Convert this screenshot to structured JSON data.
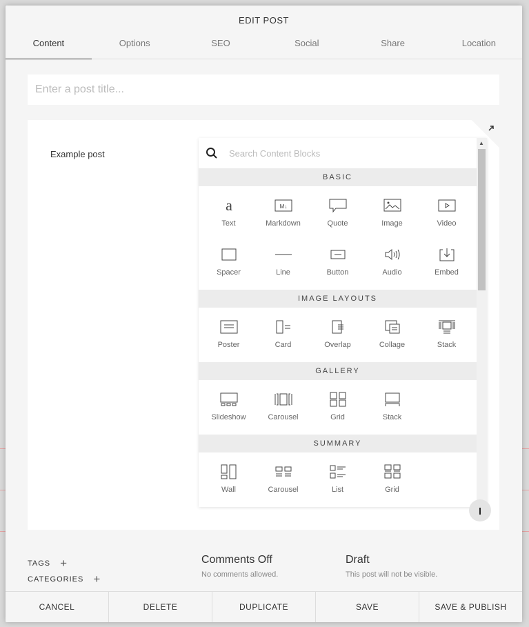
{
  "modal": {
    "title": "EDIT POST"
  },
  "tabs": [
    {
      "label": "Content"
    },
    {
      "label": "Options"
    },
    {
      "label": "SEO"
    },
    {
      "label": "Social"
    },
    {
      "label": "Share"
    },
    {
      "label": "Location"
    }
  ],
  "post": {
    "title_placeholder": "Enter a post title...",
    "title_value": "",
    "body_text": "Example post"
  },
  "block_picker": {
    "search_placeholder": "Search Content Blocks",
    "sections": [
      {
        "header": "BASIC",
        "blocks": [
          {
            "label": "Text",
            "icon": "text-icon"
          },
          {
            "label": "Markdown",
            "icon": "markdown-icon"
          },
          {
            "label": "Quote",
            "icon": "quote-icon"
          },
          {
            "label": "Image",
            "icon": "image-icon"
          },
          {
            "label": "Video",
            "icon": "video-icon"
          },
          {
            "label": "Spacer",
            "icon": "spacer-icon"
          },
          {
            "label": "Line",
            "icon": "line-icon"
          },
          {
            "label": "Button",
            "icon": "button-icon"
          },
          {
            "label": "Audio",
            "icon": "audio-icon"
          },
          {
            "label": "Embed",
            "icon": "embed-icon"
          }
        ]
      },
      {
        "header": "IMAGE LAYOUTS",
        "blocks": [
          {
            "label": "Poster",
            "icon": "poster-icon"
          },
          {
            "label": "Card",
            "icon": "card-icon"
          },
          {
            "label": "Overlap",
            "icon": "overlap-icon"
          },
          {
            "label": "Collage",
            "icon": "collage-icon"
          },
          {
            "label": "Stack",
            "icon": "stack-layout-icon"
          }
        ]
      },
      {
        "header": "GALLERY",
        "blocks": [
          {
            "label": "Slideshow",
            "icon": "slideshow-icon"
          },
          {
            "label": "Carousel",
            "icon": "carousel-icon"
          },
          {
            "label": "Grid",
            "icon": "grid-icon"
          },
          {
            "label": "Stack",
            "icon": "stack-gallery-icon"
          }
        ]
      },
      {
        "header": "SUMMARY",
        "blocks": [
          {
            "label": "Wall",
            "icon": "wall-icon"
          },
          {
            "label": "Carousel",
            "icon": "summary-carousel-icon"
          },
          {
            "label": "List",
            "icon": "list-icon"
          },
          {
            "label": "Grid",
            "icon": "summary-grid-icon"
          }
        ]
      }
    ]
  },
  "meta": {
    "tags_label": "TAGS",
    "categories_label": "CATEGORIES",
    "comments_title": "Comments Off",
    "comments_sub": "No comments allowed.",
    "status_title": "Draft",
    "status_sub": "This post will not be visible."
  },
  "footer": {
    "cancel": "CANCEL",
    "delete": "DELETE",
    "duplicate": "DUPLICATE",
    "save": "SAVE",
    "save_publish": "SAVE & PUBLISH"
  }
}
